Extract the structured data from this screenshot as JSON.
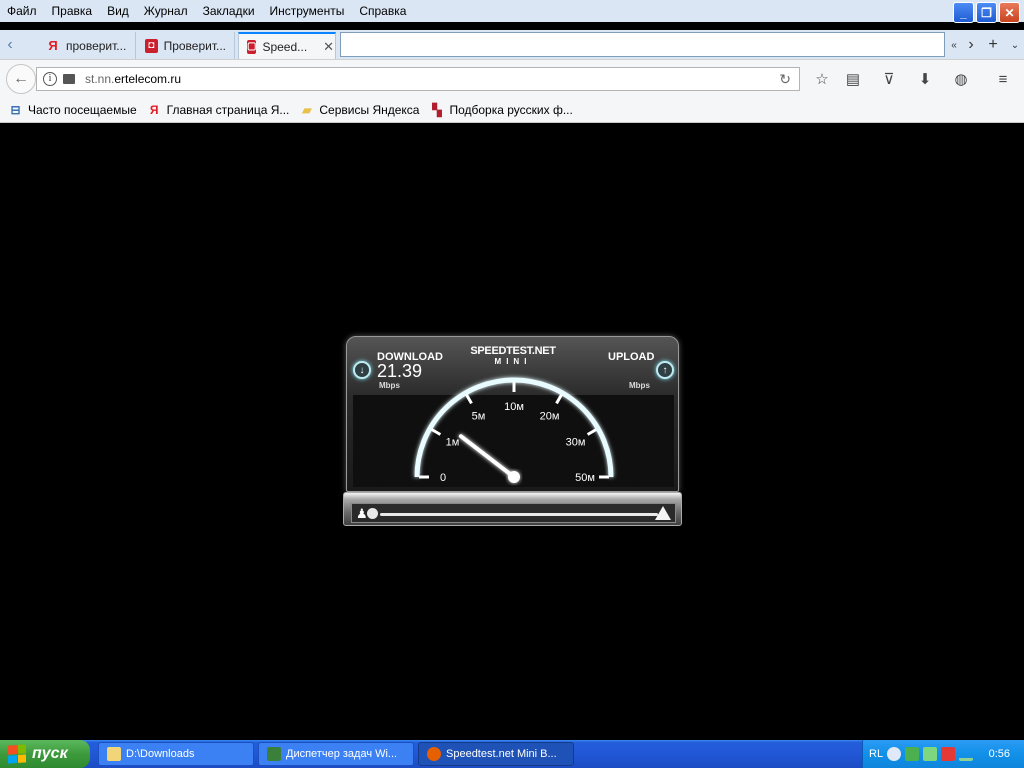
{
  "menu": [
    "Файл",
    "Правка",
    "Вид",
    "Журнал",
    "Закладки",
    "Инструменты",
    "Справка"
  ],
  "tabs": [
    {
      "title": "проверит...",
      "favicon": "yandex-icon",
      "color": "#e31e24"
    },
    {
      "title": "Проверит...",
      "favicon": "red-bag-icon",
      "color": "#cc1f2e"
    },
    {
      "title": "Speed...",
      "favicon": "speedtest-icon",
      "color": "#cc1f2e"
    }
  ],
  "url": {
    "prefix": "st.nn.",
    "domain": "ertelecom.ru"
  },
  "bookmarks": [
    {
      "label": "Часто посещаемые",
      "icon": "most-visited-icon"
    },
    {
      "label": "Главная страница Я...",
      "icon": "yandex-icon"
    },
    {
      "label": "Сервисы Яндекса",
      "icon": "folder-icon"
    },
    {
      "label": "Подборка русских ф...",
      "icon": "film-icon"
    }
  ],
  "speedtest": {
    "brand": "SPEEDTEST.NET",
    "brand_sub": "MINI",
    "download_label": "DOWNLOAD",
    "download_value": "21.39",
    "download_unit": "Mbps",
    "upload_label": "UPLOAD",
    "upload_unit": "Mbps",
    "gauge_ticks": [
      "0",
      "1м",
      "5м",
      "10м",
      "20м",
      "30м",
      "50м"
    ],
    "needle_tick_index": 1.25
  },
  "taskbar": {
    "start_label": "пуск",
    "items": [
      {
        "label": "D:\\Downloads",
        "icon": "folder-icon"
      },
      {
        "label": "Диспетчер задач Wi...",
        "icon": "task-manager-icon"
      },
      {
        "label": "Speedtest.net Mini B...",
        "icon": "firefox-icon"
      }
    ],
    "tray_lang": "RL",
    "clock": "0:56"
  },
  "colors": {
    "accent_tab": "#0a84ff",
    "gauge_glow": "#7fe8ff"
  }
}
